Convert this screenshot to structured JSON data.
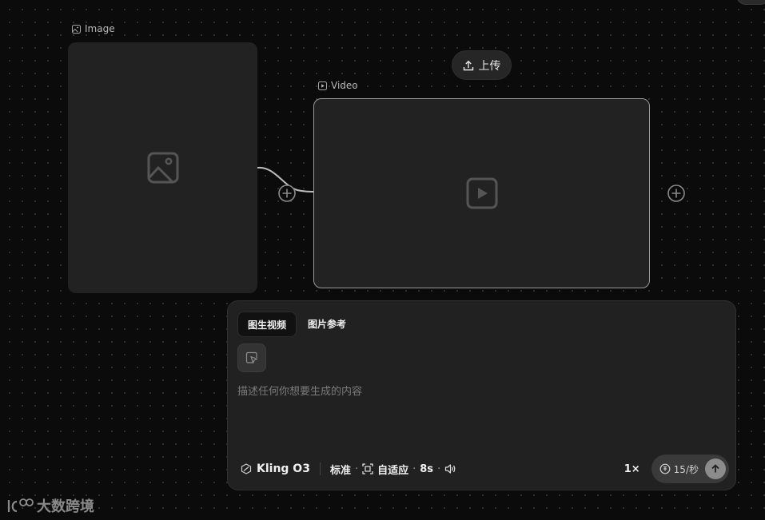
{
  "image_node": {
    "label": "Image",
    "icon": "image-icon"
  },
  "video_node": {
    "label": "Video",
    "icon": "play-icon"
  },
  "upload": {
    "label": "上传",
    "icon": "upload-icon"
  },
  "prompt_panel": {
    "tabs": [
      {
        "label": "图生视频",
        "active": true
      },
      {
        "label": "图片参考",
        "active": false
      }
    ],
    "placeholder": "描述任何你想要生成的内容",
    "model": "Kling O3",
    "quality": "标准",
    "aspect": "自适应",
    "duration": "8s",
    "sep": "·",
    "multiplier": "1×",
    "credits": "15/秒"
  },
  "watermark": {
    "text": "大数跨境"
  },
  "colors": {
    "background": "#0b0b0b",
    "node": "#222222",
    "panel": "#212121",
    "selected_border": "#9a9a9a"
  }
}
